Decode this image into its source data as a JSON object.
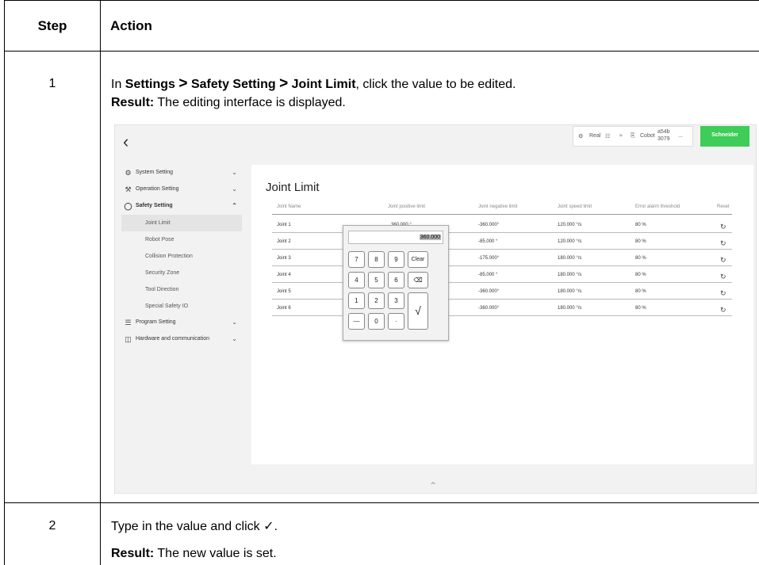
{
  "table": {
    "header_step": "Step",
    "header_action": "Action"
  },
  "step1": {
    "number": "1",
    "instr_prefix": "In ",
    "path_1": "Settings",
    "sep_1": ">",
    "path_2": "Safety Setting",
    "sep_2": ">",
    "path_3": "Joint Limit",
    "instr_suffix": ", click the value to be edited.",
    "result_label": "Result:",
    "result_text": " The editing interface is displayed."
  },
  "step2": {
    "number": "2",
    "instr": "Type in the value and click ✓.",
    "result_label": "Result:",
    "result_text": " The new value is set."
  },
  "screenshot": {
    "back_icon": "‹",
    "status": {
      "real": "Real",
      "cobot": "Cobot",
      "id_top": "a54b",
      "id_bottom": "3079",
      "more": "...",
      "brand": "Schneider"
    },
    "sidebar": {
      "system": "System Setting",
      "operation": "Operation Setting",
      "safety": "Safety Setting",
      "sub": [
        "Joint Limit",
        "Robot Pose",
        "Collision Protection",
        "Security Zone",
        "Tool Direction",
        "Special Safety IO"
      ],
      "program": "Program Setting",
      "hardware": "Hardware and communication"
    },
    "panel_title": "Joint Limit",
    "columns": [
      "Joint Name",
      "Joint positive limit",
      "Joint negative limit",
      "Joint speed limit",
      "Error alarm threshold",
      "Reset"
    ],
    "rows": [
      {
        "name": "Joint 1",
        "pos": "360.000  °",
        "neg": "-360.000°",
        "speed": "120.000 °/s",
        "alarm": "80  %"
      },
      {
        "name": "Joint 2",
        "pos": "",
        "neg": "-85.000  °",
        "speed": "120.000 °/s",
        "alarm": "80  %"
      },
      {
        "name": "Joint 3",
        "pos": "",
        "neg": "-175.000°",
        "speed": "180.000 °/s",
        "alarm": "80  %"
      },
      {
        "name": "Joint 4",
        "pos": "",
        "neg": "-85.000  °",
        "speed": "180.000 °/s",
        "alarm": "80  %"
      },
      {
        "name": "Joint 5",
        "pos": "",
        "neg": "-360.000°",
        "speed": "180.000 °/s",
        "alarm": "80  %"
      },
      {
        "name": "Joint 6",
        "pos": "",
        "neg": "-360.000°",
        "speed": "180.000 °/s",
        "alarm": "80  %"
      }
    ],
    "reset_icon": "↻",
    "keypad": {
      "display": "360.000",
      "keys": [
        "7",
        "8",
        "9",
        "Clear",
        "4",
        "5",
        "6",
        "⌫",
        "1",
        "2",
        "3",
        "√",
        "—",
        "0",
        "·"
      ]
    }
  }
}
